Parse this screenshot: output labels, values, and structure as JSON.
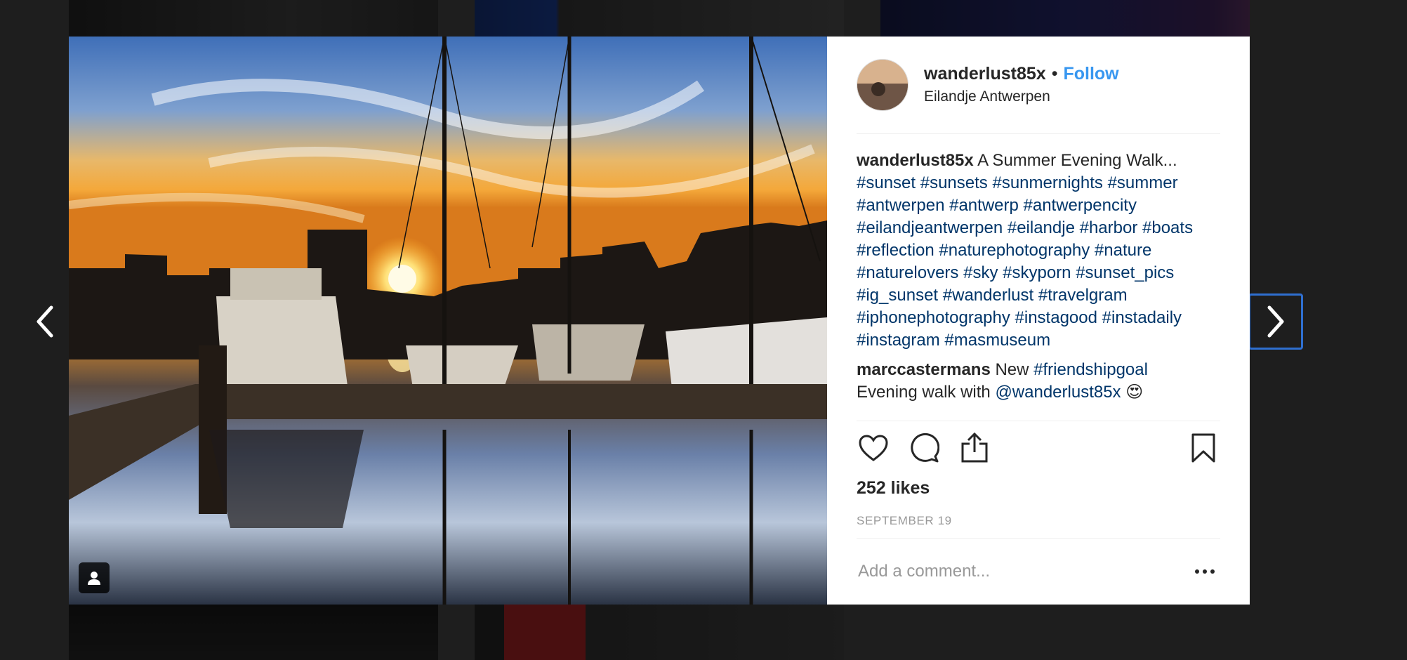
{
  "post": {
    "username": "wanderlust85x",
    "separator": "•",
    "follow_label": "Follow",
    "location": "Eilandje Antwerpen"
  },
  "caption": {
    "username": "wanderlust85x",
    "text": "A Summer Evening Walk...",
    "hashtags": [
      "#sunset",
      "#sunsets",
      "#sunmernights",
      "#summer",
      "#antwerpen",
      "#antwerp",
      "#antwerpencity",
      "#eilandjeantwerpen",
      "#eilandje",
      "#harbor",
      "#boats",
      "#reflection",
      "#naturephotography",
      "#nature",
      "#naturelovers",
      "#sky",
      "#skyporn",
      "#sunset_pics",
      "#ig_sunset",
      "#wanderlust",
      "#travelgram",
      "#iphonephotography",
      "#instagood",
      "#instadaily",
      "#instagram",
      "#masmuseum"
    ]
  },
  "comment": {
    "username": "marccastermans",
    "text_before": "New",
    "hashtag": "#friendshipgoal",
    "line2": "Evening walk with",
    "mention": "@wanderlust85x",
    "emoji": "😍"
  },
  "likes": "252 likes",
  "date": "SEPTEMBER 19",
  "comment_input": {
    "placeholder": "Add a comment..."
  },
  "icons": {
    "like": "heart-icon",
    "comment": "comment-bubble-icon",
    "share": "share-icon",
    "save": "bookmark-icon",
    "more": "more-options-icon",
    "prev": "chevron-left-icon",
    "next": "chevron-right-icon",
    "tagged": "person-tag-icon"
  },
  "colors": {
    "link": "#3897f0",
    "hashtag": "#003569",
    "text": "#262626",
    "muted": "#999999",
    "focus": "#2f6fd0"
  }
}
